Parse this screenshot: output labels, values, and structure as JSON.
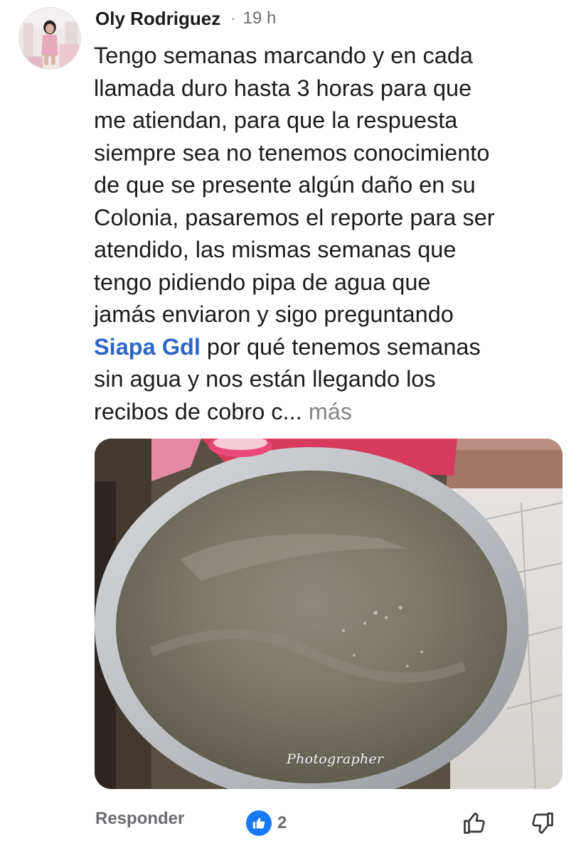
{
  "comment": {
    "author": "Oly Rodriguez",
    "separator": "·",
    "time": "19 h",
    "text_lines": [
      "Tengo semanas marcando y en cada",
      "llamada duro hasta 3 horas para que",
      "me atiendan, para que la respuesta",
      "siempre sea no tenemos conocimiento",
      "de que se presente algún daño en su",
      "Colonia, pasaremos el reporte para ser",
      "atendido, las mismas semanas que",
      "tengo pidiendo pipa de agua que",
      "jamás enviaron y sigo preguntando"
    ],
    "mention": "Siapa Gdl",
    "text_after_mention": " por qué tenemos semanas",
    "text_lines_end": [
      "sin agua y nos están llegando los",
      "recibos de cobro c..."
    ],
    "more_label": "más",
    "photo_watermark": "Photographer"
  },
  "actions": {
    "reply_label": "Responder",
    "reaction_count": "2",
    "reaction_icon": "like-icon",
    "upvote_icon": "thumbs-up-icon",
    "downvote_icon": "thumbs-down-icon"
  },
  "colors": {
    "mention": "#2d66c8",
    "like_blue": "#1877f2",
    "muted": "#6b6b70"
  }
}
